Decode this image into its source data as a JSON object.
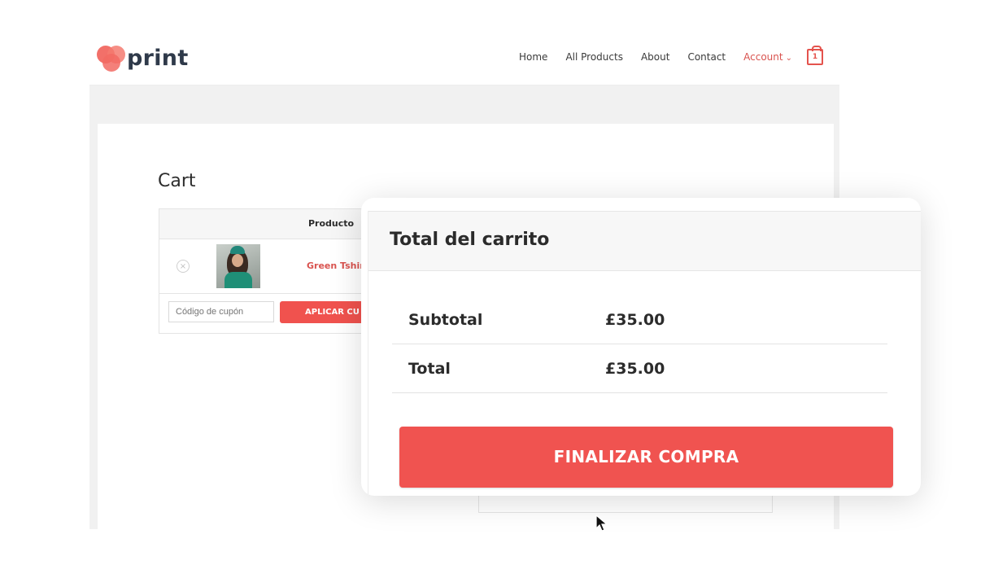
{
  "brand": {
    "name": "print",
    "accent": "#f0524e"
  },
  "nav": {
    "items": [
      "Home",
      "All Products",
      "About",
      "Contact"
    ],
    "account_label": "Account",
    "cart_count": "1"
  },
  "cart": {
    "title": "Cart",
    "column_product": "Producto",
    "product_name": "Green Tshir",
    "remove_icon": "×",
    "coupon_placeholder": "Código de cupón",
    "apply_label": "APLICAR CU"
  },
  "totals": {
    "title": "Total del carrito",
    "subtotal_label": "Subtotal",
    "subtotal_value": "£35.00",
    "total_label": "Total",
    "total_value": "£35.00",
    "checkout_label": "FINALIZAR COMPRA"
  }
}
